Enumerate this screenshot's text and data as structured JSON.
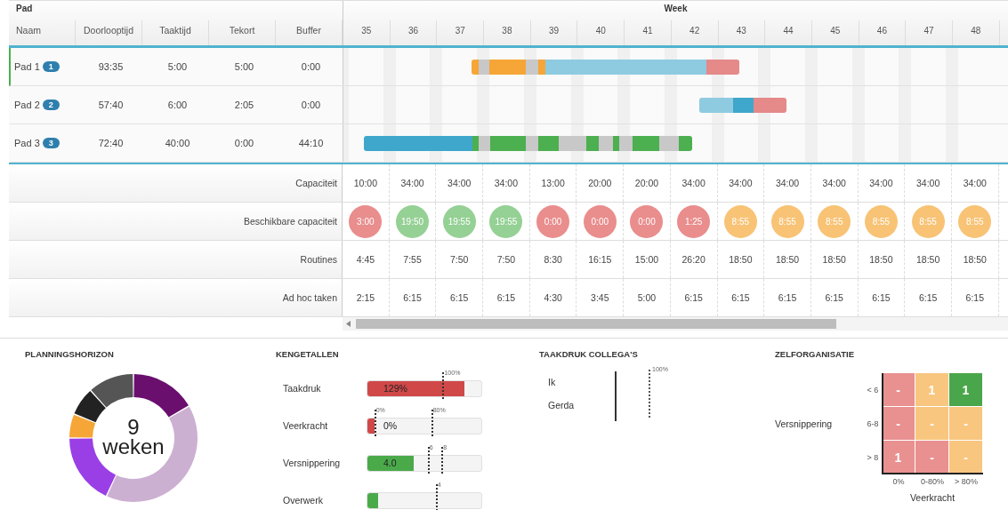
{
  "table": {
    "group_header": "Pad",
    "week_header": "Week",
    "columns": [
      "Naam",
      "Doorlooptijd",
      "Taaktijd",
      "Tekort",
      "Buffer"
    ],
    "weeks": [
      "35",
      "36",
      "37",
      "38",
      "39",
      "40",
      "41",
      "42",
      "43",
      "44",
      "45",
      "46",
      "47",
      "48"
    ],
    "paths": [
      {
        "name": "Pad 1",
        "badge": "1",
        "selected": true,
        "cells": [
          "93:35",
          "5:00",
          "5:00",
          "0:00"
        ]
      },
      {
        "name": "Pad 2",
        "badge": "2",
        "selected": false,
        "cells": [
          "57:40",
          "6:00",
          "2:05",
          "0:00"
        ]
      },
      {
        "name": "Pad 3",
        "badge": "3",
        "selected": false,
        "cells": [
          "72:40",
          "40:00",
          "0:00",
          "44:10"
        ]
      }
    ],
    "summary_rows": [
      {
        "label": "Capaciteit",
        "kind": "text",
        "values": [
          "10:00",
          "34:00",
          "34:00",
          "34:00",
          "13:00",
          "20:00",
          "20:00",
          "34:00",
          "34:00",
          "34:00",
          "34:00",
          "34:00",
          "34:00",
          "34:00"
        ]
      },
      {
        "label": "Beschikbare capaciteit",
        "kind": "circles",
        "circles": [
          {
            "text": "3:00",
            "color": "#e98d8d"
          },
          {
            "text": "19:50",
            "color": "#95d095"
          },
          {
            "text": "19:55",
            "color": "#95d095"
          },
          {
            "text": "19:55",
            "color": "#95d095"
          },
          {
            "text": "0:00",
            "color": "#e98d8d"
          },
          {
            "text": "0:00",
            "color": "#e98d8d"
          },
          {
            "text": "0:00",
            "color": "#e98d8d"
          },
          {
            "text": "1:25",
            "color": "#e98d8d"
          },
          {
            "text": "8:55",
            "color": "#f8c375"
          },
          {
            "text": "8:55",
            "color": "#f8c375"
          },
          {
            "text": "8:55",
            "color": "#f8c375"
          },
          {
            "text": "8:55",
            "color": "#f8c375"
          },
          {
            "text": "8:55",
            "color": "#f8c375"
          },
          {
            "text": "8:55",
            "color": "#f8c375"
          }
        ]
      },
      {
        "label": "Routines",
        "kind": "text",
        "values": [
          "4:45",
          "7:55",
          "7:50",
          "7:50",
          "8:30",
          "16:15",
          "15:00",
          "26:20",
          "18:50",
          "18:50",
          "18:50",
          "18:50",
          "18:50",
          "18:50"
        ]
      },
      {
        "label": "Ad hoc taken",
        "kind": "text",
        "values": [
          "2:15",
          "6:15",
          "6:15",
          "6:15",
          "4:30",
          "3:45",
          "5:00",
          "6:15",
          "6:15",
          "6:15",
          "6:15",
          "6:15",
          "6:15",
          "6:15"
        ]
      }
    ]
  },
  "planningshorizon": {
    "title": "PLANNINGSHORIZON",
    "value": "9",
    "unit": "weken"
  },
  "kengetallen": {
    "title": "KENGETALLEN",
    "metrics": [
      {
        "label": "Taakdruk",
        "value": "129%",
        "level": 0.85,
        "color": "#d04848",
        "markers": [
          {
            "label": "100%",
            "level": 0.66
          }
        ]
      },
      {
        "label": "Veerkracht",
        "value": "0%",
        "level": 0.06,
        "color": "#d04848",
        "markers": [
          {
            "label": "0%",
            "level": 0.06
          },
          {
            "label": "80%",
            "level": 0.56
          }
        ]
      },
      {
        "label": "Versnippering",
        "value": "4.0",
        "level": 0.41,
        "color": "#4aaa4a",
        "markers": [
          {
            "label": "6",
            "level": 0.53
          },
          {
            "label": "8",
            "level": 0.65
          }
        ]
      },
      {
        "label": "Overwerk",
        "level": 0.09,
        "color": "#4aaa4a",
        "markers": [
          {
            "label": "4",
            "level": 0.6
          }
        ]
      }
    ]
  },
  "taakdruk_collegas": {
    "title": "TAAKDRUK COLLEGA'S",
    "people": [
      "Ik",
      "Gerda"
    ],
    "marker": "100%"
  },
  "zelforganisatie": {
    "title": "ZELFORGANISATIE",
    "y_label": "Versnippering",
    "x_label": "Veerkracht",
    "rows": [
      "< 6",
      "6-8",
      "> 8"
    ],
    "columns": [
      "0%",
      "0-80%",
      "> 80%"
    ],
    "cells": [
      [
        {
          "text": "-",
          "color": "#e99090"
        },
        {
          "text": "1",
          "color": "#f8c67f"
        },
        {
          "text": "1",
          "color": "#4aa64a"
        }
      ],
      [
        {
          "text": "-",
          "color": "#e99090"
        },
        {
          "text": "-",
          "color": "#f8c67f"
        },
        {
          "text": "-",
          "color": "#f8c67f"
        }
      ],
      [
        {
          "text": "1",
          "color": "#e99090"
        },
        {
          "text": "-",
          "color": "#e99090"
        },
        {
          "text": "-",
          "color": "#f8c67f"
        }
      ]
    ]
  }
}
